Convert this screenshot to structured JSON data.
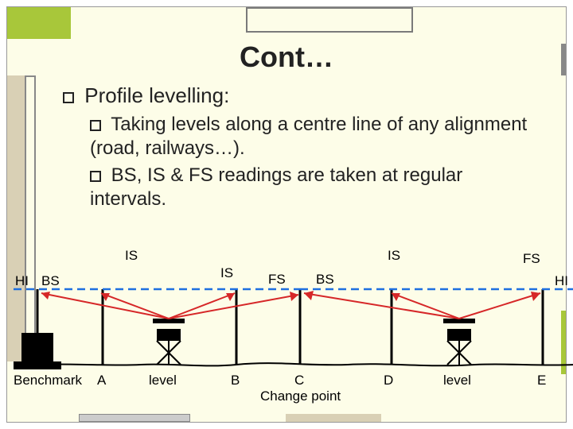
{
  "title": "Cont…",
  "heading": "Profile levelling:",
  "bullets": {
    "b1": "Taking levels along a centre line of any alignment (road, railways…).",
    "b2": "BS, IS & FS readings are taken at regular intervals."
  },
  "diagram": {
    "labels": {
      "hi_left": "HI",
      "bs_left": "BS",
      "is_1": "IS",
      "is_2": "IS",
      "fs_1": "FS",
      "bs_2": "BS",
      "is_3": "IS",
      "fs_2": "FS",
      "hi_right": "HI"
    },
    "points": {
      "benchmark": "Benchmark",
      "a": "A",
      "level1": "level",
      "b": "B",
      "c": "C",
      "change": "Change point",
      "d": "D",
      "level2": "level",
      "e": "E"
    }
  }
}
